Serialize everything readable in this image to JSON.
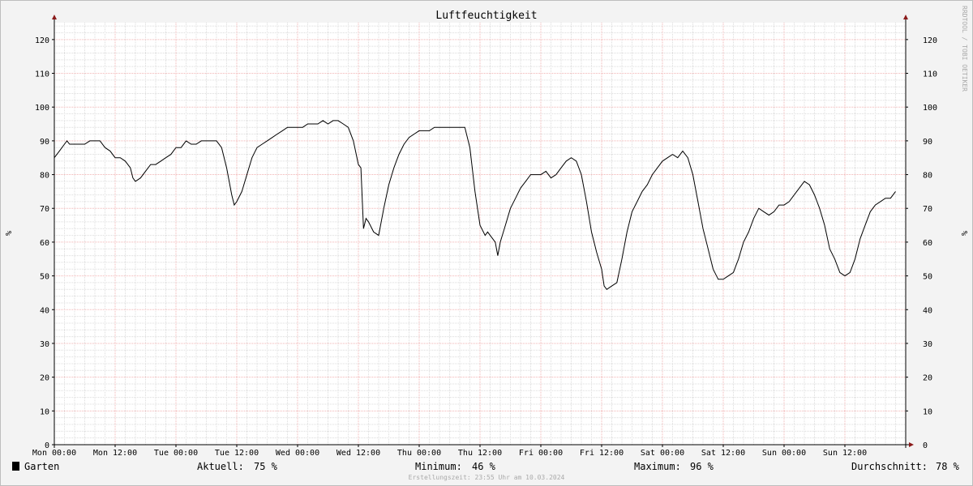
{
  "chart_data": {
    "type": "line",
    "title": "Luftfeuchtigkeit",
    "ylabel": "%",
    "ylim": [
      0,
      125
    ],
    "yticks": [
      0,
      10,
      20,
      30,
      40,
      50,
      60,
      70,
      80,
      90,
      100,
      110,
      120
    ],
    "x_range_hours": [
      0,
      168
    ],
    "x_ticks": [
      {
        "hour": 0,
        "label": "Mon 00:00"
      },
      {
        "hour": 12,
        "label": "Mon 12:00"
      },
      {
        "hour": 24,
        "label": "Tue 00:00"
      },
      {
        "hour": 36,
        "label": "Tue 12:00"
      },
      {
        "hour": 48,
        "label": "Wed 00:00"
      },
      {
        "hour": 60,
        "label": "Wed 12:00"
      },
      {
        "hour": 72,
        "label": "Thu 00:00"
      },
      {
        "hour": 84,
        "label": "Thu 12:00"
      },
      {
        "hour": 96,
        "label": "Fri 00:00"
      },
      {
        "hour": 108,
        "label": "Fri 12:00"
      },
      {
        "hour": 120,
        "label": "Sat 00:00"
      },
      {
        "hour": 132,
        "label": "Sat 12:00"
      },
      {
        "hour": 144,
        "label": "Sun 00:00"
      },
      {
        "hour": 156,
        "label": "Sun 12:00"
      }
    ],
    "grid": true,
    "series": [
      {
        "name": "Garten",
        "color": "#000000",
        "points": [
          [
            0,
            85
          ],
          [
            1,
            87
          ],
          [
            2,
            89
          ],
          [
            2.5,
            90
          ],
          [
            3,
            89
          ],
          [
            5,
            89
          ],
          [
            6,
            89
          ],
          [
            7,
            90
          ],
          [
            9,
            90
          ],
          [
            10,
            88
          ],
          [
            11,
            87
          ],
          [
            12,
            85
          ],
          [
            13,
            85
          ],
          [
            14,
            84
          ],
          [
            15,
            82
          ],
          [
            15.5,
            79
          ],
          [
            16,
            78
          ],
          [
            17,
            79
          ],
          [
            18,
            81
          ],
          [
            19,
            83
          ],
          [
            20,
            83
          ],
          [
            21,
            84
          ],
          [
            22,
            85
          ],
          [
            23,
            86
          ],
          [
            24,
            88
          ],
          [
            25,
            88
          ],
          [
            26,
            90
          ],
          [
            27,
            89
          ],
          [
            28,
            89
          ],
          [
            29,
            90
          ],
          [
            32,
            90
          ],
          [
            33,
            88
          ],
          [
            34,
            82
          ],
          [
            35,
            74
          ],
          [
            35.5,
            71
          ],
          [
            36,
            72
          ],
          [
            37,
            75
          ],
          [
            38,
            80
          ],
          [
            39,
            85
          ],
          [
            40,
            88
          ],
          [
            41,
            89
          ],
          [
            42,
            90
          ],
          [
            43,
            91
          ],
          [
            44,
            92
          ],
          [
            45,
            93
          ],
          [
            46,
            94
          ],
          [
            47,
            94
          ],
          [
            49,
            94
          ],
          [
            50,
            95
          ],
          [
            52,
            95
          ],
          [
            53,
            96
          ],
          [
            54,
            95
          ],
          [
            55,
            96
          ],
          [
            56,
            96
          ],
          [
            57,
            95
          ],
          [
            58,
            94
          ],
          [
            59,
            90
          ],
          [
            60,
            83
          ],
          [
            60.5,
            82
          ],
          [
            61,
            64
          ],
          [
            61.5,
            67
          ],
          [
            62,
            66
          ],
          [
            63,
            63
          ],
          [
            64,
            62
          ],
          [
            65,
            70
          ],
          [
            66,
            77
          ],
          [
            67,
            82
          ],
          [
            68,
            86
          ],
          [
            69,
            89
          ],
          [
            70,
            91
          ],
          [
            71,
            92
          ],
          [
            72,
            93
          ],
          [
            74,
            93
          ],
          [
            75,
            94
          ],
          [
            81,
            94
          ],
          [
            82,
            88
          ],
          [
            83,
            75
          ],
          [
            84,
            65
          ],
          [
            85,
            62
          ],
          [
            85.5,
            63
          ],
          [
            86,
            62
          ],
          [
            87,
            60
          ],
          [
            87.5,
            56
          ],
          [
            88,
            60
          ],
          [
            89,
            65
          ],
          [
            90,
            70
          ],
          [
            91,
            73
          ],
          [
            92,
            76
          ],
          [
            93,
            78
          ],
          [
            94,
            80
          ],
          [
            96,
            80
          ],
          [
            97,
            81
          ],
          [
            98,
            79
          ],
          [
            99,
            80
          ],
          [
            100,
            82
          ],
          [
            101,
            84
          ],
          [
            102,
            85
          ],
          [
            103,
            84
          ],
          [
            104,
            80
          ],
          [
            105,
            72
          ],
          [
            106,
            63
          ],
          [
            107,
            57
          ],
          [
            108,
            52
          ],
          [
            108.5,
            47
          ],
          [
            109,
            46
          ],
          [
            110,
            47
          ],
          [
            111,
            48
          ],
          [
            112,
            55
          ],
          [
            113,
            63
          ],
          [
            114,
            69
          ],
          [
            115,
            72
          ],
          [
            116,
            75
          ],
          [
            117,
            77
          ],
          [
            118,
            80
          ],
          [
            119,
            82
          ],
          [
            120,
            84
          ],
          [
            121,
            85
          ],
          [
            122,
            86
          ],
          [
            123,
            85
          ],
          [
            124,
            87
          ],
          [
            125,
            85
          ],
          [
            126,
            80
          ],
          [
            127,
            72
          ],
          [
            128,
            64
          ],
          [
            129,
            58
          ],
          [
            130,
            52
          ],
          [
            131,
            49
          ],
          [
            132,
            49
          ],
          [
            133,
            50
          ],
          [
            134,
            51
          ],
          [
            134.5,
            53
          ],
          [
            135,
            55
          ],
          [
            136,
            60
          ],
          [
            137,
            63
          ],
          [
            138,
            67
          ],
          [
            139,
            70
          ],
          [
            140,
            69
          ],
          [
            141,
            68
          ],
          [
            142,
            69
          ],
          [
            143,
            71
          ],
          [
            144,
            71
          ],
          [
            145,
            72
          ],
          [
            146,
            74
          ],
          [
            147,
            76
          ],
          [
            148,
            78
          ],
          [
            149,
            77
          ],
          [
            150,
            74
          ],
          [
            151,
            70
          ],
          [
            152,
            65
          ],
          [
            153,
            58
          ],
          [
            154,
            55
          ],
          [
            155,
            51
          ],
          [
            156,
            50
          ],
          [
            157,
            51
          ],
          [
            158,
            55
          ],
          [
            159,
            61
          ],
          [
            160,
            65
          ],
          [
            161,
            69
          ],
          [
            162,
            71
          ],
          [
            163,
            72
          ],
          [
            164,
            73
          ],
          [
            165,
            73
          ],
          [
            166,
            75
          ]
        ]
      }
    ]
  },
  "legend": {
    "swatch_color": "#000000",
    "series_label": "Garten",
    "current_label": "Aktuell:",
    "current_value": "75 %",
    "min_label": "Minimum:",
    "min_value": "46 %",
    "max_label": "Maximum:",
    "max_value": "96 %",
    "avg_label": "Durchschnitt:",
    "avg_value": "78 %"
  },
  "watermark": "RRDTOOL / TOBI OETIKER",
  "footer": "Erstellungszeit: 23:55 Uhr am 10.03.2024",
  "colors": {
    "background": "#f3f3f3",
    "plot_background": "#ffffff",
    "major_grid": "#f2b3b3",
    "minor_grid": "#dcdcdc",
    "axis": "#000000",
    "arrow": "#8b1a1a"
  }
}
